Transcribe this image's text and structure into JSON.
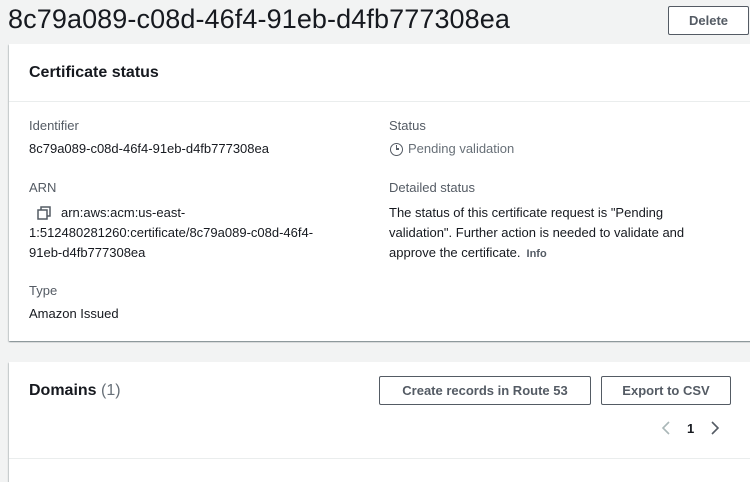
{
  "header": {
    "title": "8c79a089-c08d-46f4-91eb-d4fb777308ea",
    "delete_label": "Delete"
  },
  "certificate_status": {
    "heading": "Certificate status",
    "identifier_label": "Identifier",
    "identifier_value": "8c79a089-c08d-46f4-91eb-d4fb777308ea",
    "arn_label": "ARN",
    "arn_line1": "arn:aws:acm:us-east-",
    "arn_line2": "1:512480281260:certificate/8c79a089-c08d-46f4-",
    "arn_line3": "91eb-d4fb777308ea",
    "type_label": "Type",
    "type_value": "Amazon Issued",
    "status_label": "Status",
    "status_value": "Pending validation",
    "detailed_status_label": "Detailed status",
    "detailed_line1": "The status of this certificate request is \"Pending",
    "detailed_line2": "validation\". Further action is needed to validate and",
    "detailed_line3": "approve the certificate.",
    "info_label": "Info",
    "icons": {
      "status": "clock-icon",
      "arn": "copy-icon"
    }
  },
  "domains": {
    "heading": "Domains",
    "count": "(1)",
    "create_records_label": "Create records in Route 53",
    "export_label": "Export to CSV",
    "current_page": "1"
  }
}
